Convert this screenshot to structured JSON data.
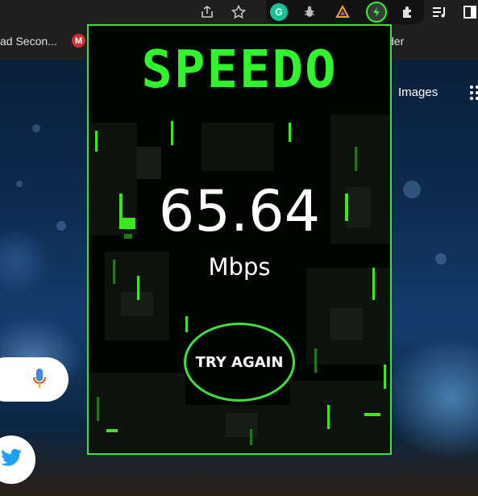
{
  "browser": {
    "bookmarks": [
      {
        "label": "ad Secon...",
        "icon": "bookmark-site-icon"
      },
      {
        "label": "der",
        "icon": "bookmark-site-icon"
      }
    ],
    "gmail_bookmark_letter": "M",
    "toolbar_icons": [
      "share-icon",
      "star-icon",
      "grammarly-icon",
      "bug-extension-icon",
      "ads-extension-icon",
      "speedo-extension-icon",
      "puzzle-extensions-icon",
      "reading-list-icon",
      "side-panel-icon"
    ],
    "grammarly_letter": "G"
  },
  "google": {
    "images_link": "Images",
    "icons": [
      "apps-grid-icon",
      "mic-icon",
      "twitter-icon"
    ]
  },
  "popup": {
    "logo_text": "SPEEDO",
    "speed_value": "65.64",
    "speed_unit": "Mbps",
    "try_again_label": "TRY AGAIN",
    "accent_color": "#3ee03a"
  }
}
